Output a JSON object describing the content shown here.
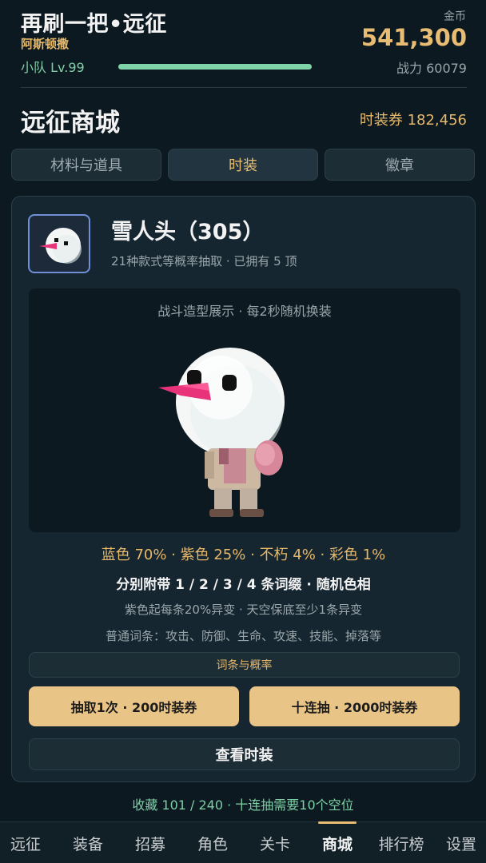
{
  "header": {
    "title": "再刷一把•远征",
    "player_name": "阿斯顿撒",
    "squad_level": "小队 Lv.99",
    "xp_progress": 1.0,
    "gold_label": "金币",
    "gold_value": "541,300",
    "power": "战力 60079"
  },
  "shop": {
    "title": "远征商城",
    "coupon_balance": "时装券 182,456",
    "tabs": [
      {
        "label": "材料与道具",
        "active": false
      },
      {
        "label": "时装",
        "active": true
      },
      {
        "label": "徽章",
        "active": false
      }
    ]
  },
  "item": {
    "icon": "snowman-head-icon",
    "name": "雪人头（305）",
    "description": "21种款式等概率抽取 · 已拥有 5 顶",
    "preview_caption": "战斗造型展示 · 每2秒随机换装",
    "rates": "蓝色 70% · 紫色 25% · 不朽 4% · 彩色 1%",
    "affix_line": "分别附带 1 / 2 / 3 / 4 条词缀 · 随机色相",
    "mutation_line": "紫色起每条20%异变 · 天空保底至少1条异变",
    "normal_affix_line": "普通词条：攻击、防御、生命、攻速、技能、掉落等",
    "affix_rate_button": "词条与概率",
    "draw_one_button": "抽取1次 · 200时装券",
    "draw_ten_button": "十连抽 · 2000时装券",
    "view_button": "查看时装"
  },
  "collection_status": "收藏 101 / 240 · 十连抽需要10个空位",
  "bottom_nav": [
    {
      "label": "远征",
      "active": false
    },
    {
      "label": "装备",
      "active": false
    },
    {
      "label": "招募",
      "active": false
    },
    {
      "label": "角色",
      "active": false
    },
    {
      "label": "关卡",
      "active": false
    },
    {
      "label": "商城",
      "active": true
    },
    {
      "label": "排行榜",
      "active": false
    },
    {
      "label": "设置",
      "active": false
    }
  ],
  "colors": {
    "accent_gold": "#e8bd73",
    "accent_green": "#7fcfa6",
    "background": "#0c1920",
    "button_gold": "#e9c487"
  }
}
